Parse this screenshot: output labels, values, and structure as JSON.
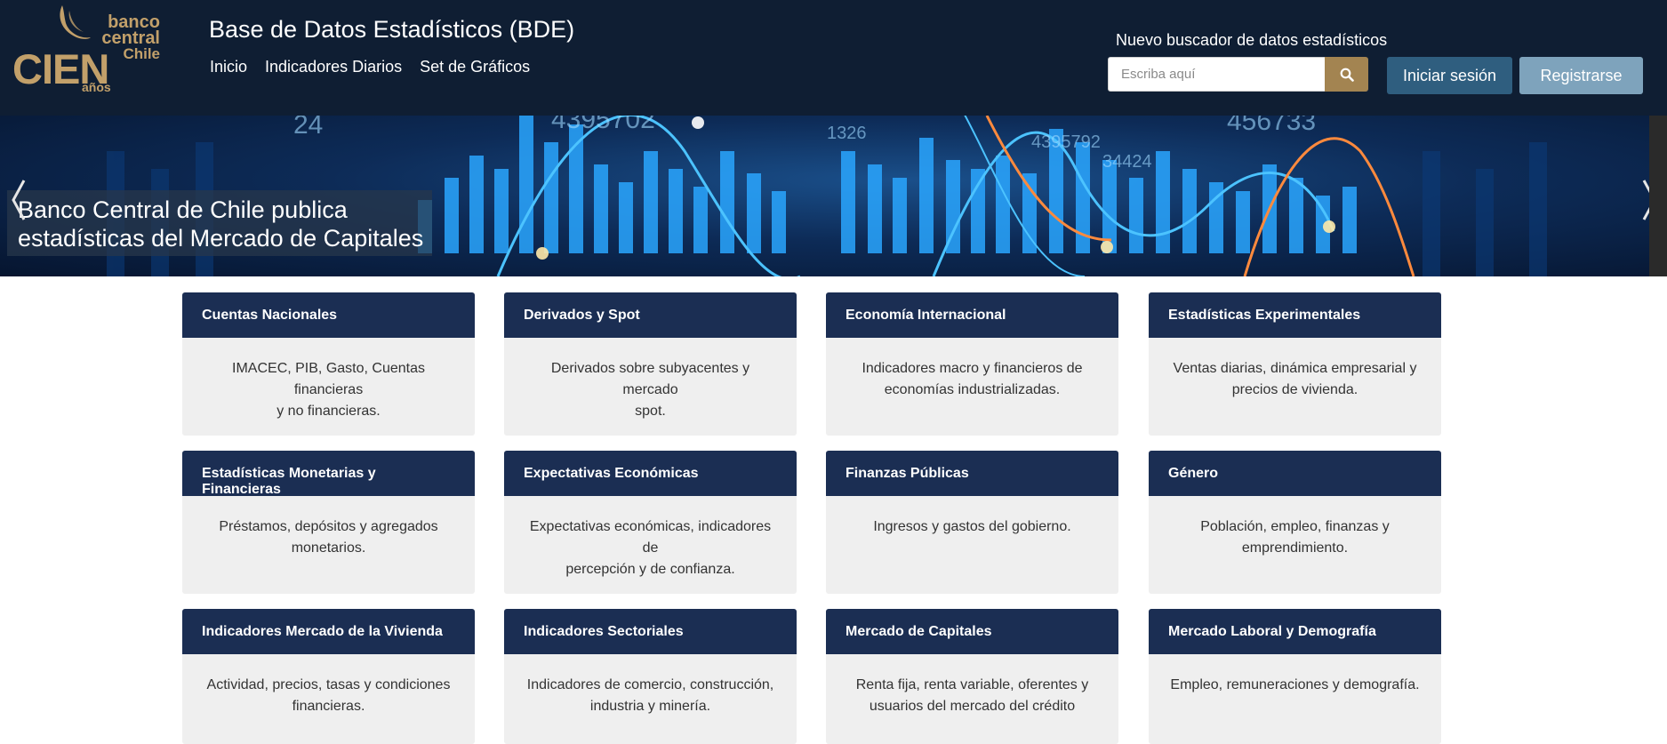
{
  "header": {
    "logo": {
      "line1": "banco",
      "line2": "central",
      "line3": "Chile",
      "cien": "CIEN",
      "anos": "años"
    },
    "title": "Base de Datos Estadísticos (BDE)",
    "nav": [
      "Inicio",
      "Indicadores Diarios",
      "Set de Gráficos"
    ],
    "search": {
      "label": "Nuevo buscador de datos estadísticos",
      "placeholder": "Escriba aquí",
      "icon": "search-icon"
    },
    "login_label": "Iniciar sesión",
    "register_label": "Registrarse"
  },
  "banner": {
    "caption_line1": "Banco Central de Chile publica",
    "caption_line2": "estadísticas del Mercado de Capitales",
    "bg_numbers": [
      "24",
      "4395702",
      "1326",
      "4395792",
      "34424",
      "456733"
    ]
  },
  "cards": [
    {
      "title": "Cuentas Nacionales",
      "desc_line1": "IMACEC, PIB, Gasto, Cuentas financieras",
      "desc_line2": "y no financieras."
    },
    {
      "title": "Derivados y Spot",
      "desc_line1": "Derivados sobre subyacentes y mercado",
      "desc_line2": "spot."
    },
    {
      "title": "Economía Internacional",
      "desc_line1": "Indicadores macro y financieros de",
      "desc_line2": "economías industrializadas."
    },
    {
      "title": "Estadísticas Experimentales",
      "desc_line1": "Ventas diarias, dinámica empresarial y",
      "desc_line2": "precios de vivienda."
    },
    {
      "title": "Estadísticas Monetarias y Financieras",
      "desc_line1": "Préstamos, depósitos y agregados",
      "desc_line2": "monetarios."
    },
    {
      "title": "Expectativas Económicas",
      "desc_line1": "Expectativas económicas, indicadores de",
      "desc_line2": "percepción y de confianza."
    },
    {
      "title": "Finanzas Públicas",
      "desc_line1": "Ingresos y gastos del gobierno.",
      "desc_line2": ""
    },
    {
      "title": "Género",
      "desc_line1": "Población, empleo, finanzas y",
      "desc_line2": "emprendimiento."
    },
    {
      "title": "Indicadores Mercado de la Vivienda",
      "desc_line1": "Actividad, precios, tasas y condiciones",
      "desc_line2": "financieras."
    },
    {
      "title": "Indicadores Sectoriales",
      "desc_line1": "Indicadores de comercio, construcción,",
      "desc_line2": "industria y minería."
    },
    {
      "title": "Mercado de Capitales",
      "desc_line1": "Renta fija, renta variable, oferentes y",
      "desc_line2": "usuarios del mercado del crédito"
    },
    {
      "title": "Mercado Laboral y Demografía",
      "desc_line1": "Empleo, remuneraciones y demografía.",
      "desc_line2": ""
    }
  ],
  "colors": {
    "header_bg": "#0f1e33",
    "card_header_bg": "#1b2e53",
    "card_body_bg": "#efefef",
    "gold": "#c2a06a",
    "search_button": "#a38451",
    "login_button": "#2f5e7f",
    "register_button": "#7ea3bc"
  }
}
